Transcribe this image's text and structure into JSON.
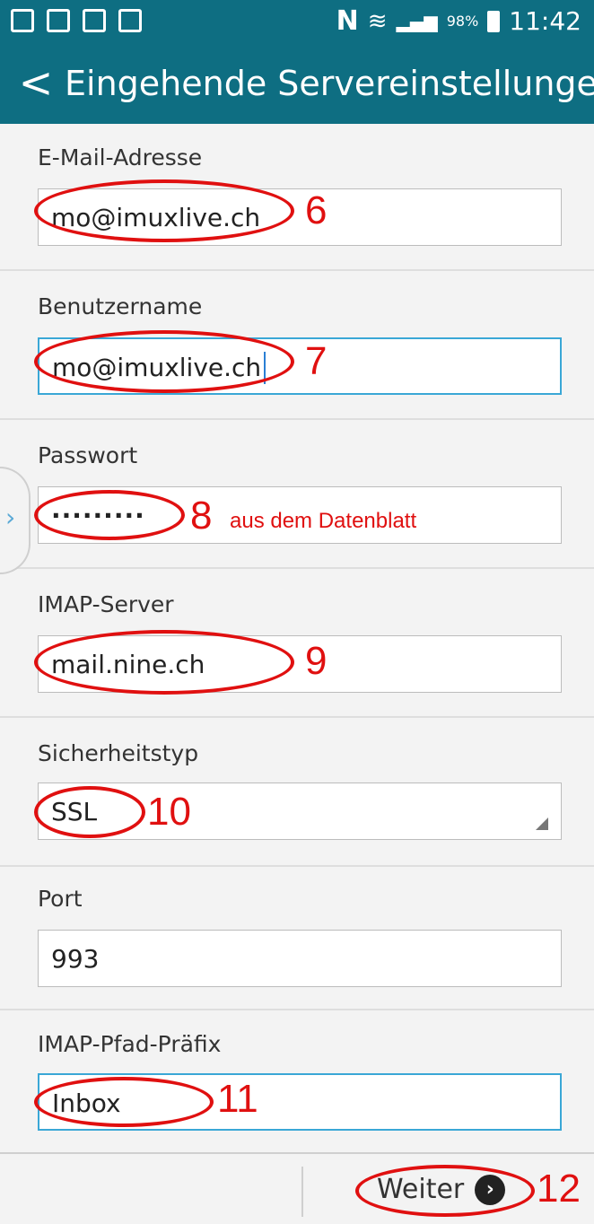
{
  "status_bar": {
    "icons_left": [
      "gallery-icon",
      "screenshot-icon",
      "email-icon",
      "clipboard-icon"
    ],
    "nfc": "N",
    "battery_percent": "98%",
    "time": "11:42"
  },
  "header": {
    "back_glyph": "<",
    "title": "Eingehende Servereinstellungen",
    "accent_color": "#0e6e82"
  },
  "form": {
    "email_label": "E-Mail-Adresse",
    "email_value": "mo@imuxlive.ch",
    "username_label": "Benutzername",
    "username_value": "mo@imuxlive.ch",
    "password_label": "Passwort",
    "password_value": "·········",
    "server_label": "IMAP-Server",
    "server_value": "mail.nine.ch",
    "security_label": "Sicherheitstyp",
    "security_value": "SSL",
    "port_label": "Port",
    "port_value": "993",
    "prefix_label": "IMAP-Pfad-Präfix",
    "prefix_value": "Inbox"
  },
  "annotations": {
    "n6": "6",
    "n7": "7",
    "n8": "8",
    "n8_note": "aus dem  Datenblatt",
    "n9": "9",
    "n10": "10",
    "n11": "11",
    "n12": "12",
    "color": "#e01010"
  },
  "footer": {
    "next_label": "Weiter",
    "next_icon": "›"
  }
}
